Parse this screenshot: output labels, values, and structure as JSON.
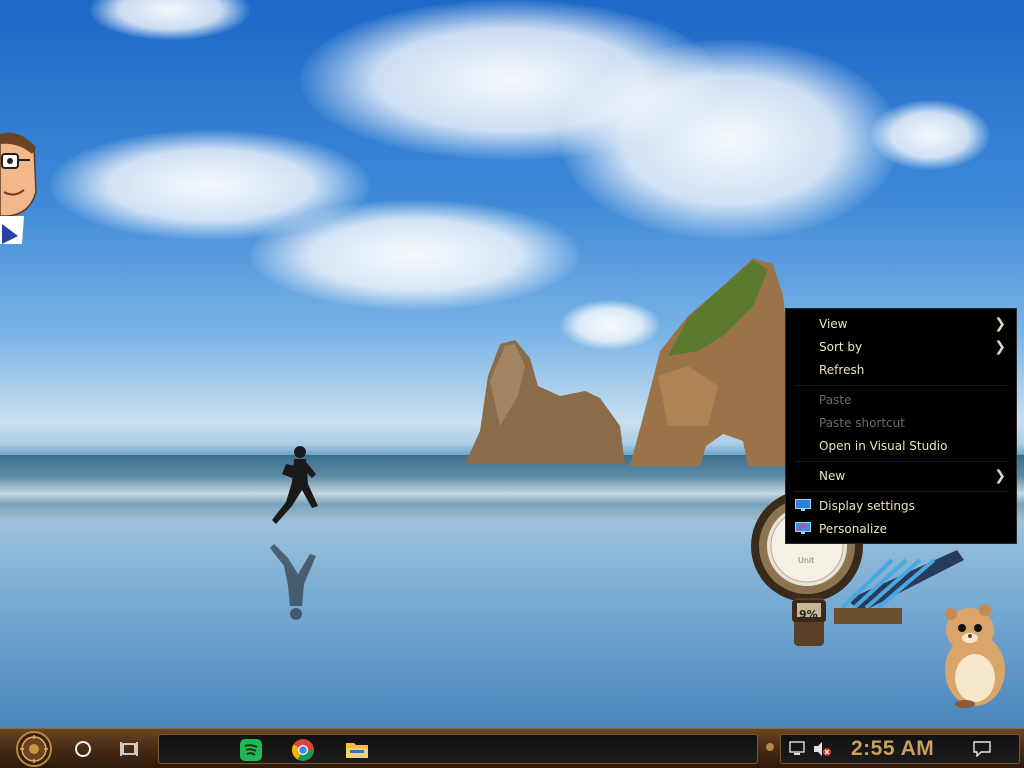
{
  "context_menu": {
    "items": [
      {
        "label": "View",
        "submenu": true,
        "enabled": true
      },
      {
        "label": "Sort by",
        "submenu": true,
        "enabled": true
      },
      {
        "label": "Refresh",
        "submenu": false,
        "enabled": true
      },
      {
        "label": "Paste",
        "submenu": false,
        "enabled": false
      },
      {
        "label": "Paste shortcut",
        "submenu": false,
        "enabled": false
      },
      {
        "label": "Open in Visual Studio",
        "submenu": false,
        "enabled": true
      },
      {
        "label": "New",
        "submenu": true,
        "enabled": true
      },
      {
        "label": "Display settings",
        "submenu": false,
        "enabled": true,
        "icon": "display-icon"
      },
      {
        "label": "Personalize",
        "submenu": false,
        "enabled": true,
        "icon": "personalize-icon"
      }
    ]
  },
  "gauge": {
    "label": "Unit",
    "percent_text": "9%"
  },
  "taskbar": {
    "clock": "2:55 AM",
    "pinned": [
      {
        "name": "spotify-icon",
        "color": "#1db954"
      },
      {
        "name": "chrome-icon",
        "color": "#db4437"
      },
      {
        "name": "file-explorer-icon",
        "color": "#f2c230"
      }
    ]
  },
  "colors": {
    "menu_bg": "#000000",
    "menu_text": "#f0e4b8",
    "menu_disabled": "#6e6a60",
    "clock_color": "#c9a15a",
    "taskbar_brown": "#4b2d16"
  }
}
